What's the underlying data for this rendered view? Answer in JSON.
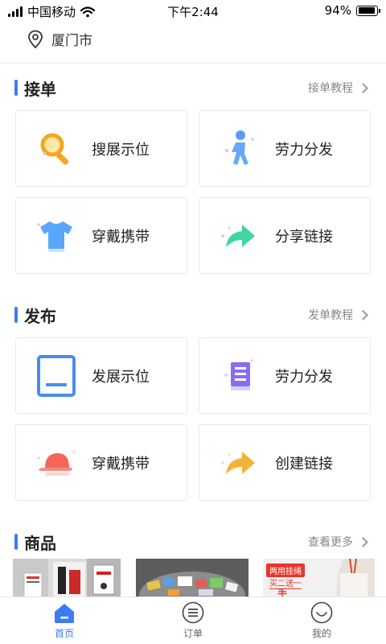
{
  "status_bar": {
    "carrier": "中国移动",
    "time": "下午2:44",
    "battery_text": "94%",
    "battery_level": 0.94
  },
  "location": {
    "city": "厦门市"
  },
  "sections": {
    "accept": {
      "title": "接单",
      "more": "接单教程",
      "cards": [
        {
          "label": "搜展示位",
          "icon": "search-icon"
        },
        {
          "label": "劳力分发",
          "icon": "person-walking-icon"
        },
        {
          "label": "穿戴携带",
          "icon": "tshirt-icon"
        },
        {
          "label": "分享链接",
          "icon": "share-arrow-icon"
        }
      ]
    },
    "publish": {
      "title": "发布",
      "more": "发单教程",
      "cards": [
        {
          "label": "发展示位",
          "icon": "display-board-icon"
        },
        {
          "label": "劳力分发",
          "icon": "document-list-icon"
        },
        {
          "label": "穿戴携带",
          "icon": "cap-icon"
        },
        {
          "label": "创建链接",
          "icon": "share-arrow-icon"
        }
      ]
    },
    "products": {
      "title": "商品",
      "more": "查看更多",
      "thumb3_banner": "两用挂绳",
      "thumb3_promo": "买二送一",
      "thumb3_bottom": "手"
    }
  },
  "bottom_nav": {
    "items": [
      {
        "label": "首页",
        "icon": "home-icon",
        "active": true
      },
      {
        "label": "订单",
        "icon": "order-list-icon",
        "active": false
      },
      {
        "label": "我的",
        "icon": "profile-smile-icon",
        "active": false
      }
    ]
  },
  "colors": {
    "accent": "#3b7cf6",
    "search_orange": "#f5a623",
    "person_blue": "#5b9af5",
    "shirt_blue": "#5aa6f8",
    "share_green": "#3fd6a0",
    "cap_red": "#f5665a",
    "share_orange": "#f5b23a",
    "doc_purple": "#8a6cf0"
  }
}
